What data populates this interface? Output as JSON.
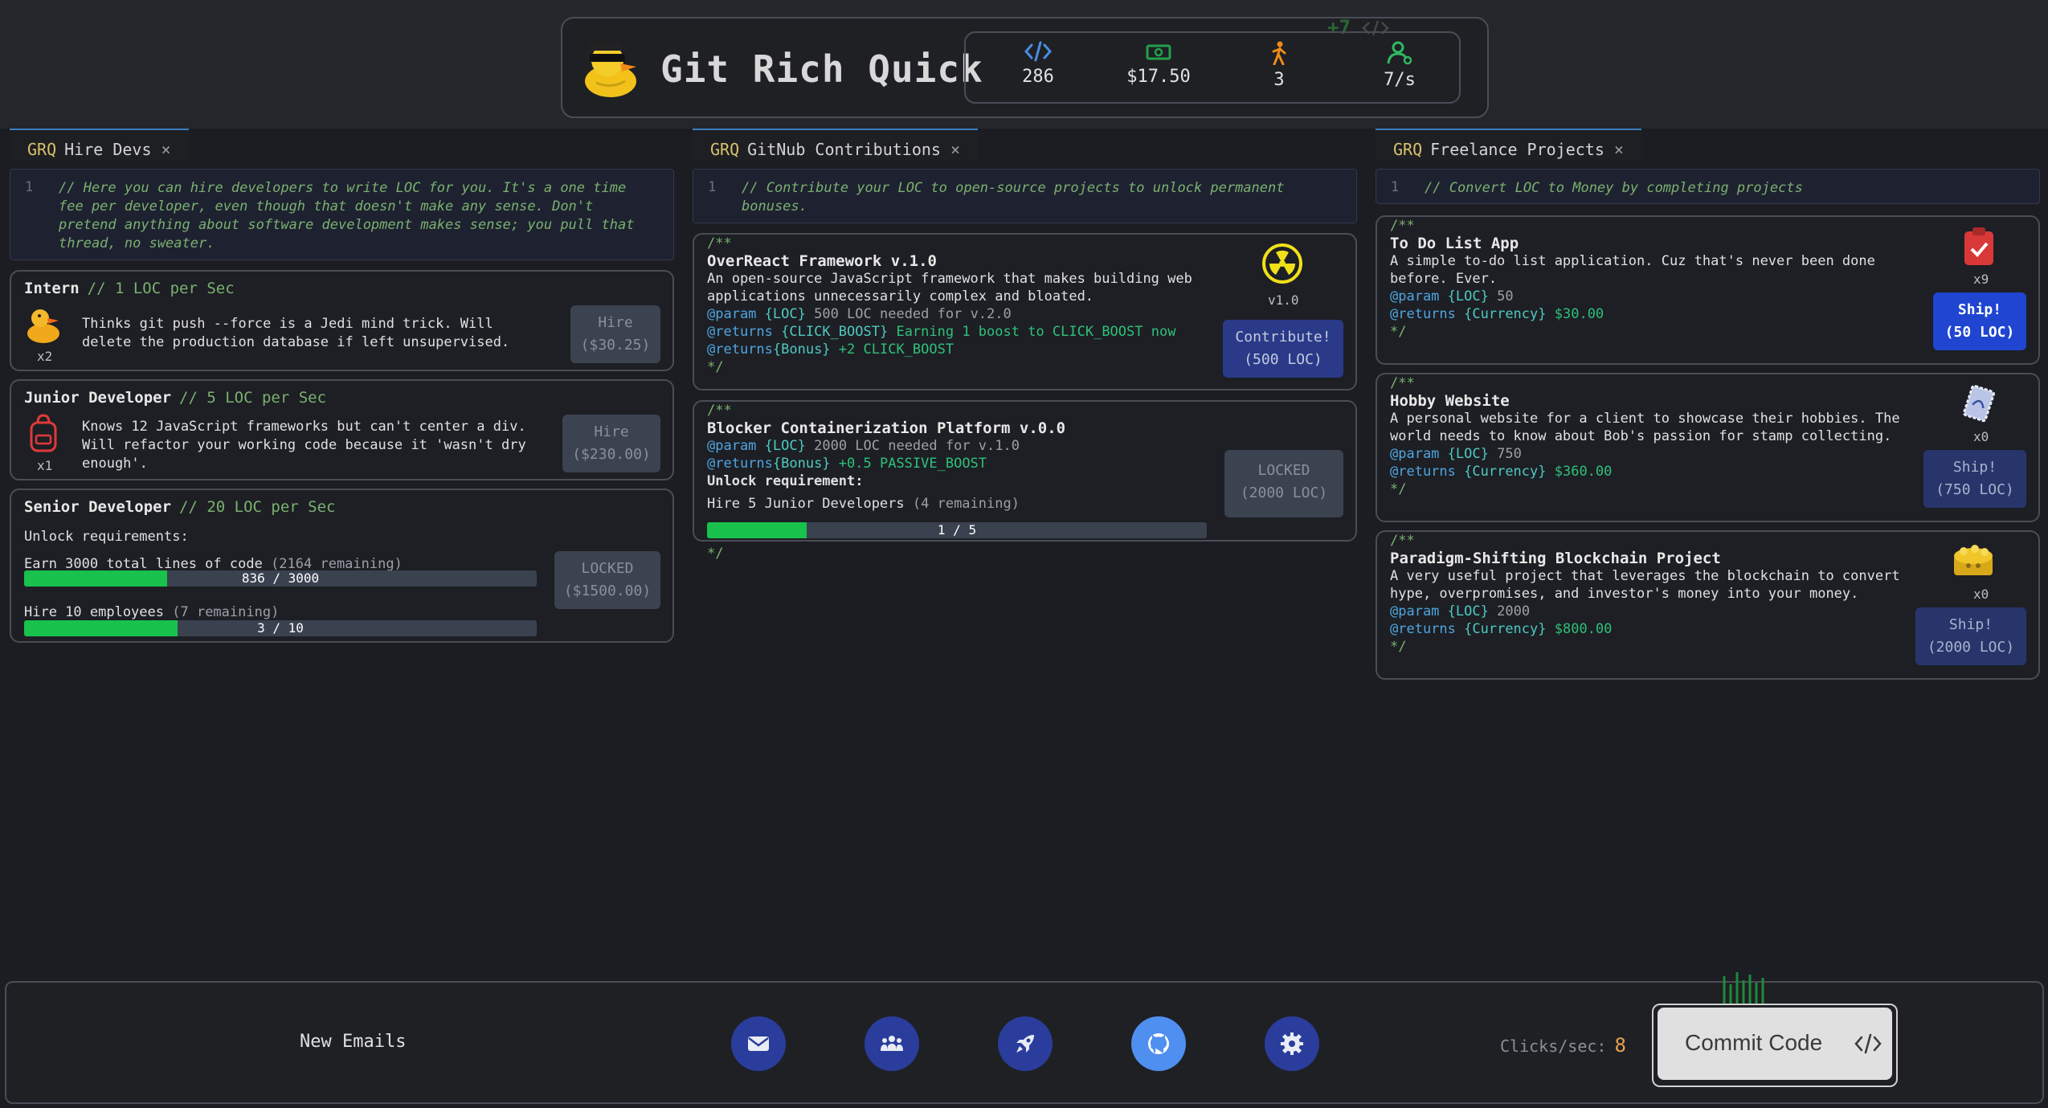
{
  "header": {
    "title": "Git Rich Quick",
    "stats": [
      {
        "icon": "code-icon",
        "value": "286"
      },
      {
        "icon": "money-icon",
        "value": "$17.50"
      },
      {
        "icon": "person-icon",
        "value": "3"
      },
      {
        "icon": "employees-icon",
        "value": "7/s"
      }
    ],
    "float_text": "+7"
  },
  "hire_panel": {
    "tab_prefix": "GRQ",
    "tab_title": "Hire Devs",
    "tab_close": "×",
    "line_no": "1",
    "comment": "// Here you can hire developers to write LOC for you. It's a one time fee per developer, even though that doesn't make any sense. Don't pretend anything about software development makes sense; you pull that thread, no sweater.",
    "devs": [
      {
        "name": "Intern",
        "rate": "// 1 LOC per Sec",
        "desc": "Thinks git push --force is a Jedi mind trick. Will delete the production database if left unsupervised.",
        "count": "x2",
        "btn_line1": "Hire",
        "btn_line2": "($30.25)"
      },
      {
        "name": "Junior Developer",
        "rate": "// 5 LOC per Sec",
        "desc": "Knows 12 JavaScript frameworks but can't center a div. Will refactor your working code because it 'wasn't dry enough'.",
        "count": "x1",
        "btn_line1": "Hire",
        "btn_line2": "($230.00)"
      },
      {
        "name": "Senior Developer",
        "rate": "// 20 LOC per Sec",
        "unlock_label": "Unlock requirements:",
        "req1_text": "Earn 3000 total lines of code",
        "req1_remaining": "(2164 remaining)",
        "req1_progress": "836 / 3000",
        "req1_fraction": 0.279,
        "req2_text": "Hire 10 employees",
        "req2_remaining": "(7 remaining)",
        "req2_progress": "3 / 10",
        "req2_fraction": 0.3,
        "btn_line1": "LOCKED",
        "btn_line2": "($1500.00)"
      }
    ]
  },
  "gitnub_panel": {
    "tab_prefix": "GRQ",
    "tab_title": "GitNub Contributions",
    "tab_close": "×",
    "line_no": "1",
    "comment": "// Contribute your LOC to open-source projects to unlock permanent bonuses.",
    "projects": [
      {
        "open": "/**",
        "title": "OverReact Framework v.1.0",
        "desc1": "An open-source JavaScript framework that makes building web",
        "desc2": "applications unnecessarily complex and bloated.",
        "p_tag": "@param",
        "p_type": "{LOC}",
        "p_text": "500 LOC needed for v.2.0",
        "r_tag": "@returns",
        "r_type": "{CLICK_BOOST}",
        "r_text": "Earning 1 boost to CLICK_BOOST now",
        "b_tag": "@returns",
        "b_type": "{Bonus}",
        "b_text": "+2 CLICK_BOOST",
        "close": "*/",
        "version": "v1.0",
        "btn_line1": "Contribute!",
        "btn_line2": "(500 LOC)"
      },
      {
        "open": "/**",
        "title": "Blocker Containerization Platform v.0.0",
        "p_tag": "@param",
        "p_type": "{LOC}",
        "p_text": "2000 LOC needed for v.1.0",
        "b_tag": "@returns",
        "b_type": "{Bonus}",
        "b_text": "+0.5 PASSIVE_BOOST",
        "unlock_label": "Unlock requirement:",
        "req_text": "Hire 5 Junior Developers",
        "req_remaining": "(4 remaining)",
        "req_progress": "1 / 5",
        "req_fraction": 0.2,
        "close": "*/",
        "btn_line1": "LOCKED",
        "btn_line2": "(2000 LOC)"
      }
    ]
  },
  "freelance_panel": {
    "tab_prefix": "GRQ",
    "tab_title": "Freelance Projects",
    "tab_close": "×",
    "line_no": "1",
    "comment": "// Convert LOC to Money by completing projects",
    "projects": [
      {
        "open": "/**",
        "title": "To Do List App",
        "desc1": "A simple to-do list application. Cuz that's never been done",
        "desc2": "before. Ever.",
        "p_tag": "@param",
        "p_type": "{LOC}",
        "p_val": "50",
        "r_tag": "@returns",
        "r_type": "{Currency}",
        "r_val": "$30.00",
        "close": "*/",
        "count": "x9",
        "btn_line1": "Ship!",
        "btn_line2": "(50 LOC)"
      },
      {
        "open": "/**",
        "title": "Hobby Website",
        "desc1": "A personal website for a client to showcase their hobbies. The",
        "desc2": "world needs to know about Bob's passion for stamp collecting.",
        "p_tag": "@param",
        "p_type": "{LOC}",
        "p_val": "750",
        "r_tag": "@returns",
        "r_type": "{Currency}",
        "r_val": "$360.00",
        "close": "*/",
        "count": "x0",
        "btn_line1": "Ship!",
        "btn_line2": "(750 LOC)"
      },
      {
        "open": "/**",
        "title": "Paradigm-Shifting Blockchain Project",
        "desc1": "A very useful project that leverages the blockchain to convert",
        "desc2": "hype, overpromises, and investor's money into your money.",
        "p_tag": "@param",
        "p_type": "{LOC}",
        "p_val": "2000",
        "r_tag": "@returns",
        "r_type": "{Currency}",
        "r_val": "$800.00",
        "close": "*/",
        "count": "x0",
        "btn_line1": "Ship!",
        "btn_line2": "(2000 LOC)"
      }
    ]
  },
  "footer": {
    "new_emails": "New Emails",
    "nav": [
      {
        "icon": "mail-icon"
      },
      {
        "icon": "team-icon"
      },
      {
        "icon": "rocket-icon"
      },
      {
        "icon": "github-icon",
        "active": true
      },
      {
        "icon": "settings-icon"
      }
    ],
    "clicks_label": "Clicks/sec:",
    "clicks_value": "8",
    "commit_label": "Commit Code"
  },
  "colors": {
    "accent_blue": "#1f45d1",
    "progress_green": "#18c24c",
    "comment_green": "#7bb070"
  }
}
